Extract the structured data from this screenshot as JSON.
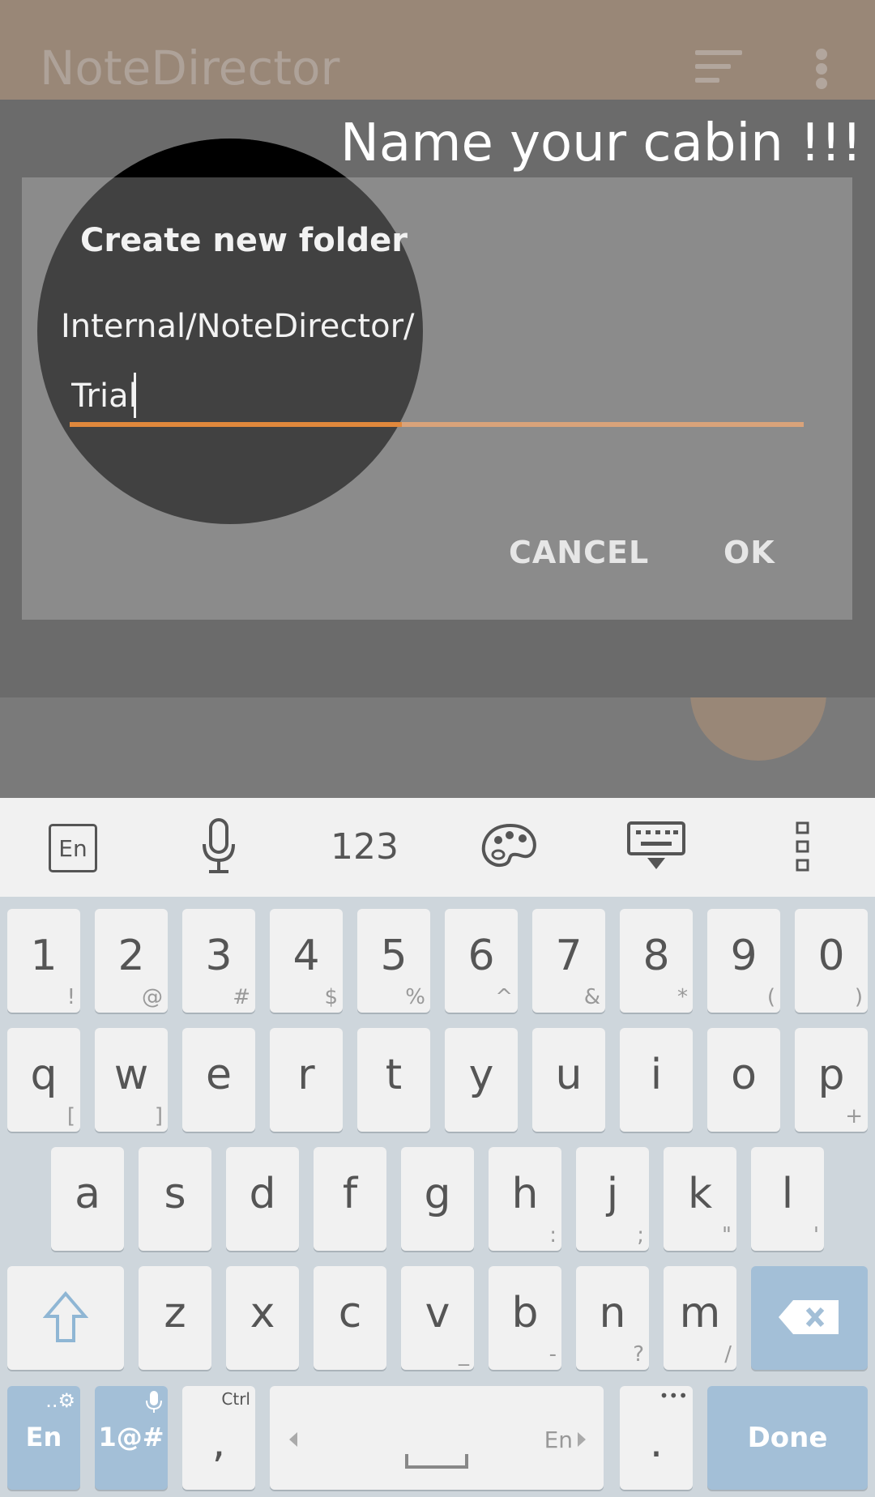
{
  "appbar": {
    "title": "NoteDirector",
    "sort_icon": "sort-icon",
    "more_icon": "more-vert-icon"
  },
  "tutorial": {
    "caption": "Name your cabin !!!"
  },
  "dialog": {
    "title": "Create new folder",
    "path": "Internal/NoteDirector/",
    "input_value": "Trial",
    "cancel_label": "CANCEL",
    "ok_label": "OK",
    "accent_color": "#e0883c"
  },
  "keyboard": {
    "toolbar": {
      "lang_label": "En",
      "numbers_label": "123"
    },
    "rows": {
      "numbers": [
        {
          "main": "1",
          "sub": "!"
        },
        {
          "main": "2",
          "sub": "@"
        },
        {
          "main": "3",
          "sub": "#"
        },
        {
          "main": "4",
          "sub": "$"
        },
        {
          "main": "5",
          "sub": "%"
        },
        {
          "main": "6",
          "sub": "^"
        },
        {
          "main": "7",
          "sub": "&"
        },
        {
          "main": "8",
          "sub": "*"
        },
        {
          "main": "9",
          "sub": "("
        },
        {
          "main": "0",
          "sub": ")"
        }
      ],
      "top": [
        {
          "main": "q",
          "sub": "["
        },
        {
          "main": "w",
          "sub": "]"
        },
        {
          "main": "e",
          "sub": ""
        },
        {
          "main": "r",
          "sub": ""
        },
        {
          "main": "t",
          "sub": ""
        },
        {
          "main": "y",
          "sub": ""
        },
        {
          "main": "u",
          "sub": ""
        },
        {
          "main": "i",
          "sub": ""
        },
        {
          "main": "o",
          "sub": ""
        },
        {
          "main": "p",
          "sub": "+"
        }
      ],
      "middle": [
        {
          "main": "a",
          "sub": ""
        },
        {
          "main": "s",
          "sub": ""
        },
        {
          "main": "d",
          "sub": ""
        },
        {
          "main": "f",
          "sub": ""
        },
        {
          "main": "g",
          "sub": ""
        },
        {
          "main": "h",
          "sub": ":"
        },
        {
          "main": "j",
          "sub": ";"
        },
        {
          "main": "k",
          "sub": "\""
        },
        {
          "main": "l",
          "sub": "'"
        }
      ],
      "bottom": [
        {
          "main": "z",
          "sub": ""
        },
        {
          "main": "x",
          "sub": ""
        },
        {
          "main": "c",
          "sub": ""
        },
        {
          "main": "v",
          "sub": "_"
        },
        {
          "main": "b",
          "sub": "-"
        },
        {
          "main": "n",
          "sub": "?"
        },
        {
          "main": "m",
          "sub": "/"
        }
      ]
    },
    "bottom_bar": {
      "lang_key": "En",
      "lang_sub": "..⚙",
      "symbols_key": "1@#",
      "comma_key": ",",
      "comma_sub": "Ctrl",
      "space_lang": "En",
      "period_key": ".",
      "period_sub": "•••",
      "done_key": "Done"
    },
    "accent_color": "#a3bfd7"
  }
}
